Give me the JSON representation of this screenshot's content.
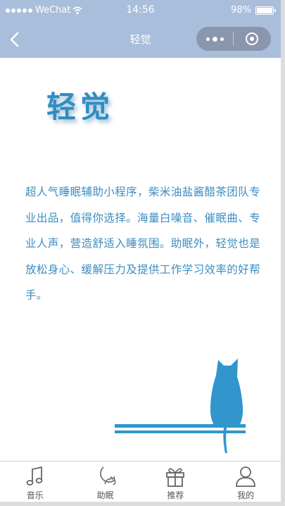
{
  "status_bar": {
    "carrier": "WeChat",
    "time": "14:56",
    "battery_text": "98%",
    "battery_level": 0.98
  },
  "nav": {
    "title": "轻觉"
  },
  "logo_text": "轻觉",
  "description": "超人气睡眠辅助小程序，柴米油盐酱醋茶团队专业出品，值得你选择。海量白噪音、催眠曲、专业人声，营造舒适入睡氛围。助眠外，轻觉也是放松身心、缓解压力及提供工作学习效率的好帮手。",
  "tabs": [
    {
      "label": "音乐",
      "icon": "music-note-icon"
    },
    {
      "label": "助眠",
      "icon": "moon-cat-icon"
    },
    {
      "label": "推荐",
      "icon": "gift-icon"
    },
    {
      "label": "我的",
      "icon": "user-icon"
    }
  ],
  "colors": {
    "header_bg": "#a9bedb",
    "capsule_bg": "#8a96ad",
    "text_blue": "#3c8dc1",
    "logo_blue": "#2f8ec4",
    "cat_blue": "#3196cd"
  }
}
